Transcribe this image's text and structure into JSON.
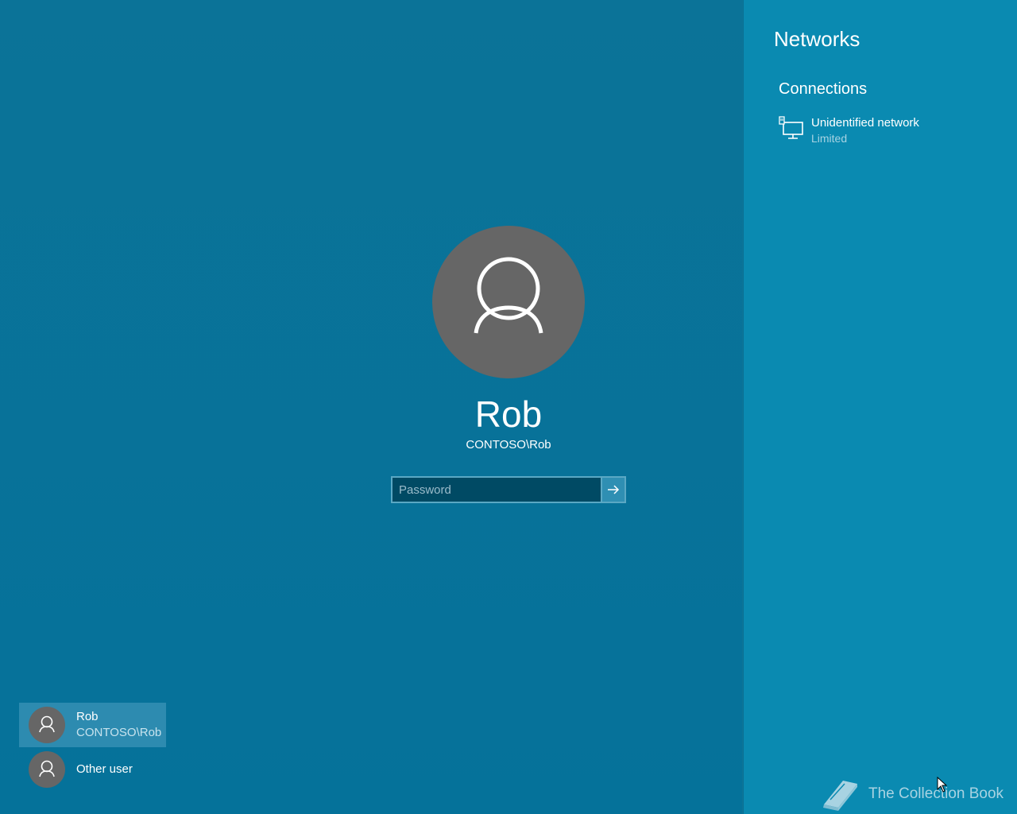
{
  "login": {
    "user_name": "Rob",
    "user_domain": "CONTOSO\\Rob",
    "password_placeholder": "Password",
    "submit_icon": "arrow-right-icon"
  },
  "user_list": [
    {
      "name": "Rob",
      "sub": "CONTOSO\\Rob",
      "selected": true
    },
    {
      "name": "Other user",
      "selected": false
    }
  ],
  "networks": {
    "title": "Networks",
    "section": "Connections",
    "items": [
      {
        "name": "Unidentified network",
        "status": "Limited",
        "icon": "wired-network-icon"
      }
    ]
  },
  "watermark": {
    "text": "The Collection Book",
    "icon": "book-icon"
  },
  "colors": {
    "background": "#0b7398",
    "pane": "#0a8ab1",
    "avatar": "#666666",
    "selected_tile": "#2d8bb0",
    "password_bg": "#004a64"
  }
}
